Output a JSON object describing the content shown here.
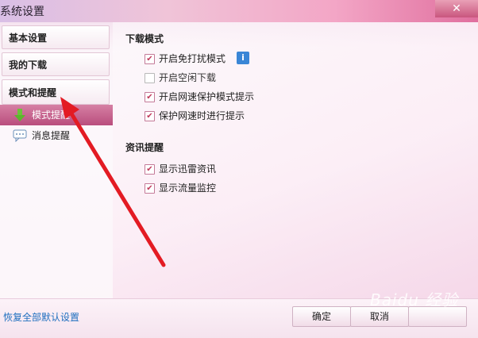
{
  "window": {
    "title": "系统设置",
    "close_label": "✕"
  },
  "sidebar": {
    "items": [
      {
        "label": "基本设置"
      },
      {
        "label": "我的下载"
      },
      {
        "label": "模式和提醒"
      }
    ],
    "sub_items": [
      {
        "label": "模式提醒",
        "icon": "green-down-arrow-icon",
        "active": true
      },
      {
        "label": "消息提醒",
        "icon": "speech-bubble-icon",
        "active": false
      }
    ]
  },
  "download_mode": {
    "title": "下载模式",
    "options": [
      {
        "label": "开启免打扰模式",
        "checked": true
      },
      {
        "label": "开启空闲下载",
        "checked": false
      },
      {
        "label": "开启网速保护模式提示",
        "checked": true
      },
      {
        "label": "保护网速时进行提示",
        "checked": true
      }
    ],
    "info_label": "i"
  },
  "news": {
    "title": "资讯提醒",
    "options": [
      {
        "label": "显示迅雷资讯",
        "checked": true
      },
      {
        "label": "显示流量监控",
        "checked": true
      }
    ]
  },
  "footer": {
    "restore_label": "恢复全部默认设置",
    "ok_label": "确定",
    "cancel_label": "取消",
    "apply_label": ""
  },
  "watermark": "Baidu 经验",
  "colors": {
    "accent": "#c0395a",
    "active_tab": "#b94d7d",
    "link": "#1f6fbf",
    "annotation": "#e31b23"
  }
}
